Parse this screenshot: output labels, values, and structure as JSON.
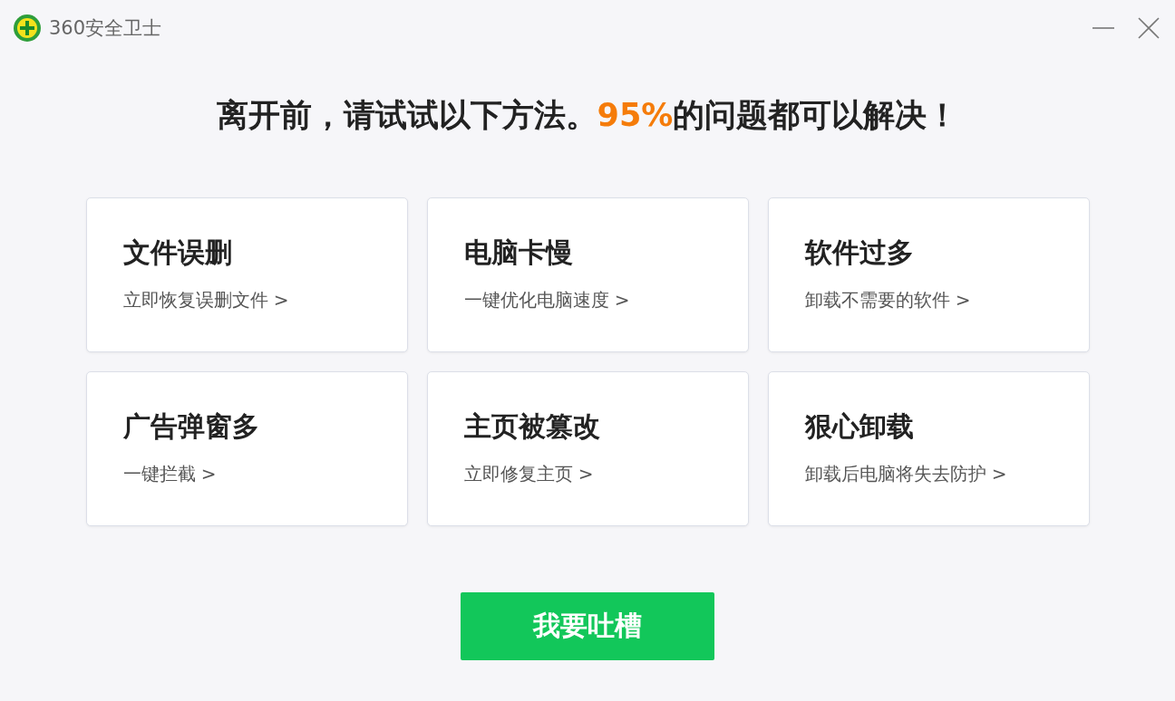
{
  "window": {
    "title": "360安全卫士"
  },
  "heading": {
    "before": "离开前，请试试以下方法。",
    "highlight": "95%",
    "after": "的问题都可以解决！"
  },
  "cards": [
    {
      "title": "文件误删",
      "action": "立即恢复误删文件 >"
    },
    {
      "title": "电脑卡慢",
      "action": "一键优化电脑速度 >"
    },
    {
      "title": "软件过多",
      "action": "卸载不需要的软件 >"
    },
    {
      "title": "广告弹窗多",
      "action": "一键拦截 >"
    },
    {
      "title": "主页被篡改",
      "action": "立即修复主页 >"
    },
    {
      "title": "狠心卸载",
      "action": "卸载后电脑将失去防护 >"
    }
  ],
  "button": {
    "label": "我要吐槽"
  }
}
